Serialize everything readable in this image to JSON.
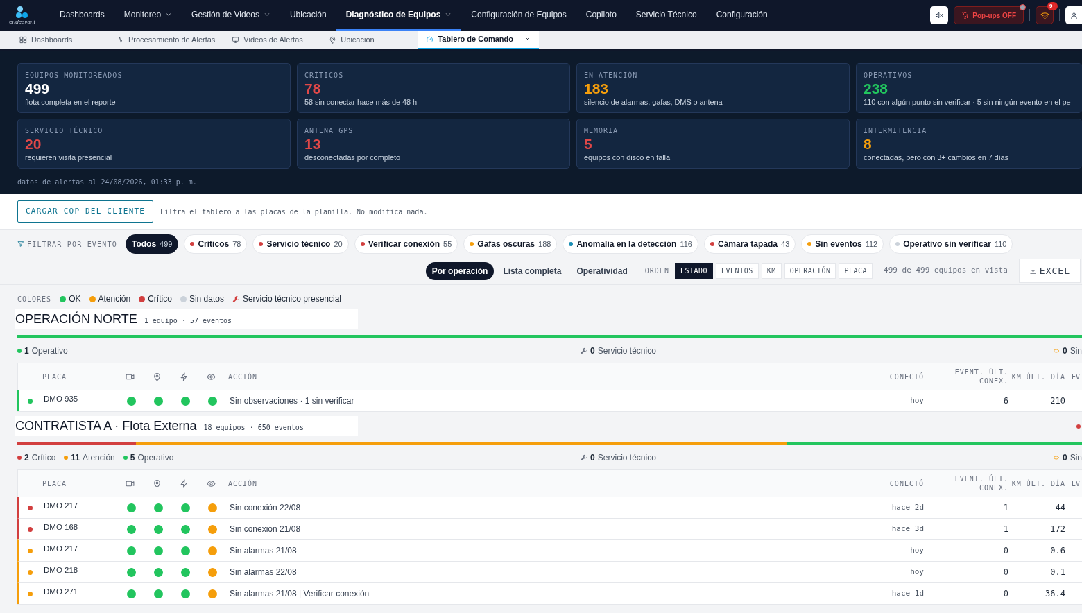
{
  "nav": {
    "brand": "endeavant",
    "items": [
      {
        "label": "Dashboards",
        "dropdown": false,
        "selected": false
      },
      {
        "label": "Monitoreo",
        "dropdown": true,
        "selected": false
      },
      {
        "label": "Gestión de Videos",
        "dropdown": true,
        "selected": false
      },
      {
        "label": "Ubicación",
        "dropdown": false,
        "selected": false
      },
      {
        "label": "Diagnóstico de Equipos",
        "dropdown": true,
        "selected": true
      },
      {
        "label": "Configuración de Equipos",
        "dropdown": false,
        "selected": false
      },
      {
        "label": "Copiloto",
        "dropdown": false,
        "selected": false
      },
      {
        "label": "Servicio Técnico",
        "dropdown": false,
        "selected": false
      },
      {
        "label": "Configuración",
        "dropdown": false,
        "selected": false
      }
    ],
    "popups": "Pop-ups OFF",
    "badge": "9+"
  },
  "tabs": [
    {
      "label": "Dashboards",
      "selected": false
    },
    {
      "label": "Procesamiento de Alertas",
      "selected": false
    },
    {
      "label": "Videos de Alertas",
      "selected": false
    },
    {
      "label": "Ubicación",
      "selected": false
    },
    {
      "label": "Tablero de Comando",
      "selected": true
    }
  ],
  "kpis": [
    {
      "label": "EQUIPOS MONITOREADOS",
      "value": "499",
      "note": "flota completa en el reporte",
      "color": "#ffffff"
    },
    {
      "label": "CRÍTICOS",
      "value": "78",
      "note": "58 sin conectar hace más de 48 h",
      "color": "#e04848"
    },
    {
      "label": "EN ATENCIÓN",
      "value": "183",
      "note": "silencio de alarmas, gafas, DMS o antena",
      "color": "#f59e0b"
    },
    {
      "label": "OPERATIVOS",
      "value": "238",
      "note": "110 con algún punto sin verificar · 5 sin ningún evento en el pe",
      "color": "#22c55e"
    },
    {
      "label": "SERVICIO TÉCNICO",
      "value": "20",
      "note": "requieren visita presencial",
      "color": "#e04848"
    },
    {
      "label": "ANTENA GPS",
      "value": "13",
      "note": "desconectadas por completo",
      "color": "#e04848"
    },
    {
      "label": "MEMORIA",
      "value": "5",
      "note": "equipos con disco en falla",
      "color": "#e04848"
    },
    {
      "label": "INTERMITENCIA",
      "value": "8",
      "note": "conectadas, pero con 3+ cambios en 7 días",
      "color": "#f59e0b"
    }
  ],
  "timestamp": "datos de alertas al 24/08/2026, 01:33 p. m.",
  "cop": {
    "button": "CARGAR COP DEL CLIENTE",
    "hint": "Filtra el tablero a las placas de la planilla. No modifica nada."
  },
  "filter": {
    "label": "FILTRAR POR EVENTO",
    "chips": [
      {
        "label": "Todos",
        "count": "499",
        "selected": true
      },
      {
        "label": "Críticos",
        "count": "78",
        "color": "#d23f3f",
        "selected": false
      },
      {
        "label": "Servicio técnico",
        "count": "20",
        "color": "#d23f3f",
        "selected": false
      },
      {
        "label": "Verificar conexión",
        "count": "55",
        "color": "#d23f3f",
        "selected": false
      },
      {
        "label": "Gafas oscuras",
        "count": "188",
        "color": "#f59e0b",
        "selected": false
      },
      {
        "label": "Anomalía en la detección",
        "count": "116",
        "color": "#1c8fb5",
        "selected": false
      },
      {
        "label": "Cámara tapada",
        "count": "43",
        "color": "#d23f3f",
        "selected": false
      },
      {
        "label": "Sin eventos",
        "count": "112",
        "color": "#f59e0b",
        "selected": false
      },
      {
        "label": "Operativo sin verificar",
        "count": "110",
        "color": "#cbd2da",
        "selected": false
      }
    ]
  },
  "views": [
    {
      "label": "Por operación",
      "selected": true
    },
    {
      "label": "Lista completa",
      "selected": false
    },
    {
      "label": "Operatividad",
      "selected": false
    }
  ],
  "order": {
    "label": "ORDEN",
    "sorts": [
      {
        "label": "ESTADO",
        "selected": true
      },
      {
        "label": "EVENTOS",
        "selected": false
      },
      {
        "label": "KM",
        "selected": false
      },
      {
        "label": "OPERACIÓN",
        "selected": false
      },
      {
        "label": "PLACA",
        "selected": false
      }
    ]
  },
  "in_view": "499 de 499 equipos en vista",
  "excel": "EXCEL",
  "legend": {
    "label": "COLORES",
    "items": [
      {
        "kind": "dot",
        "label": "OK",
        "color": "#22c55e"
      },
      {
        "kind": "dot",
        "label": "Atención",
        "color": "#f59e0b"
      },
      {
        "kind": "dot",
        "label": "Crítico",
        "color": "#d23f3f"
      },
      {
        "kind": "dot",
        "label": "Sin datos",
        "color": "#cbd2da"
      },
      {
        "kind": "wrench",
        "label": "Servicio técnico presencial",
        "color": "#d23f3f"
      }
    ]
  },
  "groups": [
    {
      "title": "OPERACIÓN NORTE",
      "summary": "1 equipo · 57 eventos",
      "right_dot": false,
      "counts": [
        {
          "count": "1",
          "label": "Operativo",
          "color": "#22c55e"
        }
      ],
      "service": {
        "count": "0",
        "label": "Servicio técnico"
      },
      "right": {
        "count": "0",
        "label": "Sin"
      },
      "columns": [
        "PLACA",
        "ACCIÓN",
        "CONECTÓ",
        "EVENT. ÚLT. CONEX.",
        "KM ÚLT. DÍA",
        "EV"
      ],
      "rows": [
        {
          "placa": "DMO 935",
          "color": "#22c55e",
          "checks": [
            {
              "color": "#22c55e"
            },
            {
              "color": "#22c55e"
            },
            {
              "color": "#22c55e"
            },
            {
              "color": "#22c55e"
            }
          ],
          "action": "Sin observaciones · 1 sin verificar",
          "connected": "hoy",
          "events": "6",
          "km": "210"
        }
      ]
    },
    {
      "title": "CONTRATISTA A · Flota Externa",
      "summary": "18 equipos · 650 eventos",
      "right_dot": true,
      "counts": [
        {
          "count": "2",
          "label": "Crítico",
          "color": "#d23f3f"
        },
        {
          "count": "11",
          "label": "Atención",
          "color": "#f59e0b"
        },
        {
          "count": "5",
          "label": "Operativo",
          "color": "#22c55e"
        }
      ],
      "service": {
        "count": "0",
        "label": "Servicio técnico"
      },
      "right": {
        "count": "0",
        "label": "Sin"
      },
      "columns": [
        "PLACA",
        "ACCIÓN",
        "CONECTÓ",
        "EVENT. ÚLT. CONEX.",
        "KM ÚLT. DÍA",
        "EV"
      ],
      "rows": [
        {
          "placa": "DMO 217",
          "color": "#d23f3f",
          "checks": [
            {
              "color": "#22c55e"
            },
            {
              "color": "#22c55e"
            },
            {
              "color": "#22c55e"
            },
            {
              "color": "#f59e0b"
            }
          ],
          "action": "Sin conexión 22/08",
          "connected": "hace 2d",
          "events": "1",
          "km": "44"
        },
        {
          "placa": "DMO 168",
          "color": "#d23f3f",
          "checks": [
            {
              "color": "#22c55e"
            },
            {
              "color": "#22c55e"
            },
            {
              "color": "#22c55e"
            },
            {
              "color": "#f59e0b"
            }
          ],
          "action": "Sin conexión 21/08",
          "connected": "hace 3d",
          "events": "1",
          "km": "172"
        },
        {
          "placa": "DMO 217",
          "color": "#f59e0b",
          "checks": [
            {
              "color": "#22c55e"
            },
            {
              "color": "#22c55e"
            },
            {
              "color": "#22c55e"
            },
            {
              "color": "#f59e0b"
            }
          ],
          "action": "Sin alarmas 21/08",
          "connected": "hoy",
          "events": "0",
          "km": "0.6"
        },
        {
          "placa": "DMO 218",
          "color": "#f59e0b",
          "checks": [
            {
              "color": "#22c55e"
            },
            {
              "color": "#22c55e"
            },
            {
              "color": "#22c55e"
            },
            {
              "color": "#f59e0b"
            }
          ],
          "action": "Sin alarmas 22/08",
          "connected": "hoy",
          "events": "0",
          "km": "0.1"
        },
        {
          "placa": "DMO 271",
          "color": "#f59e0b",
          "checks": [
            {
              "color": "#22c55e"
            },
            {
              "color": "#22c55e"
            },
            {
              "color": "#22c55e"
            },
            {
              "color": "#f59e0b"
            }
          ],
          "action": "Sin alarmas 21/08 | Verificar conexión",
          "connected": "hace 1d",
          "events": "0",
          "km": "36.4"
        }
      ]
    }
  ]
}
